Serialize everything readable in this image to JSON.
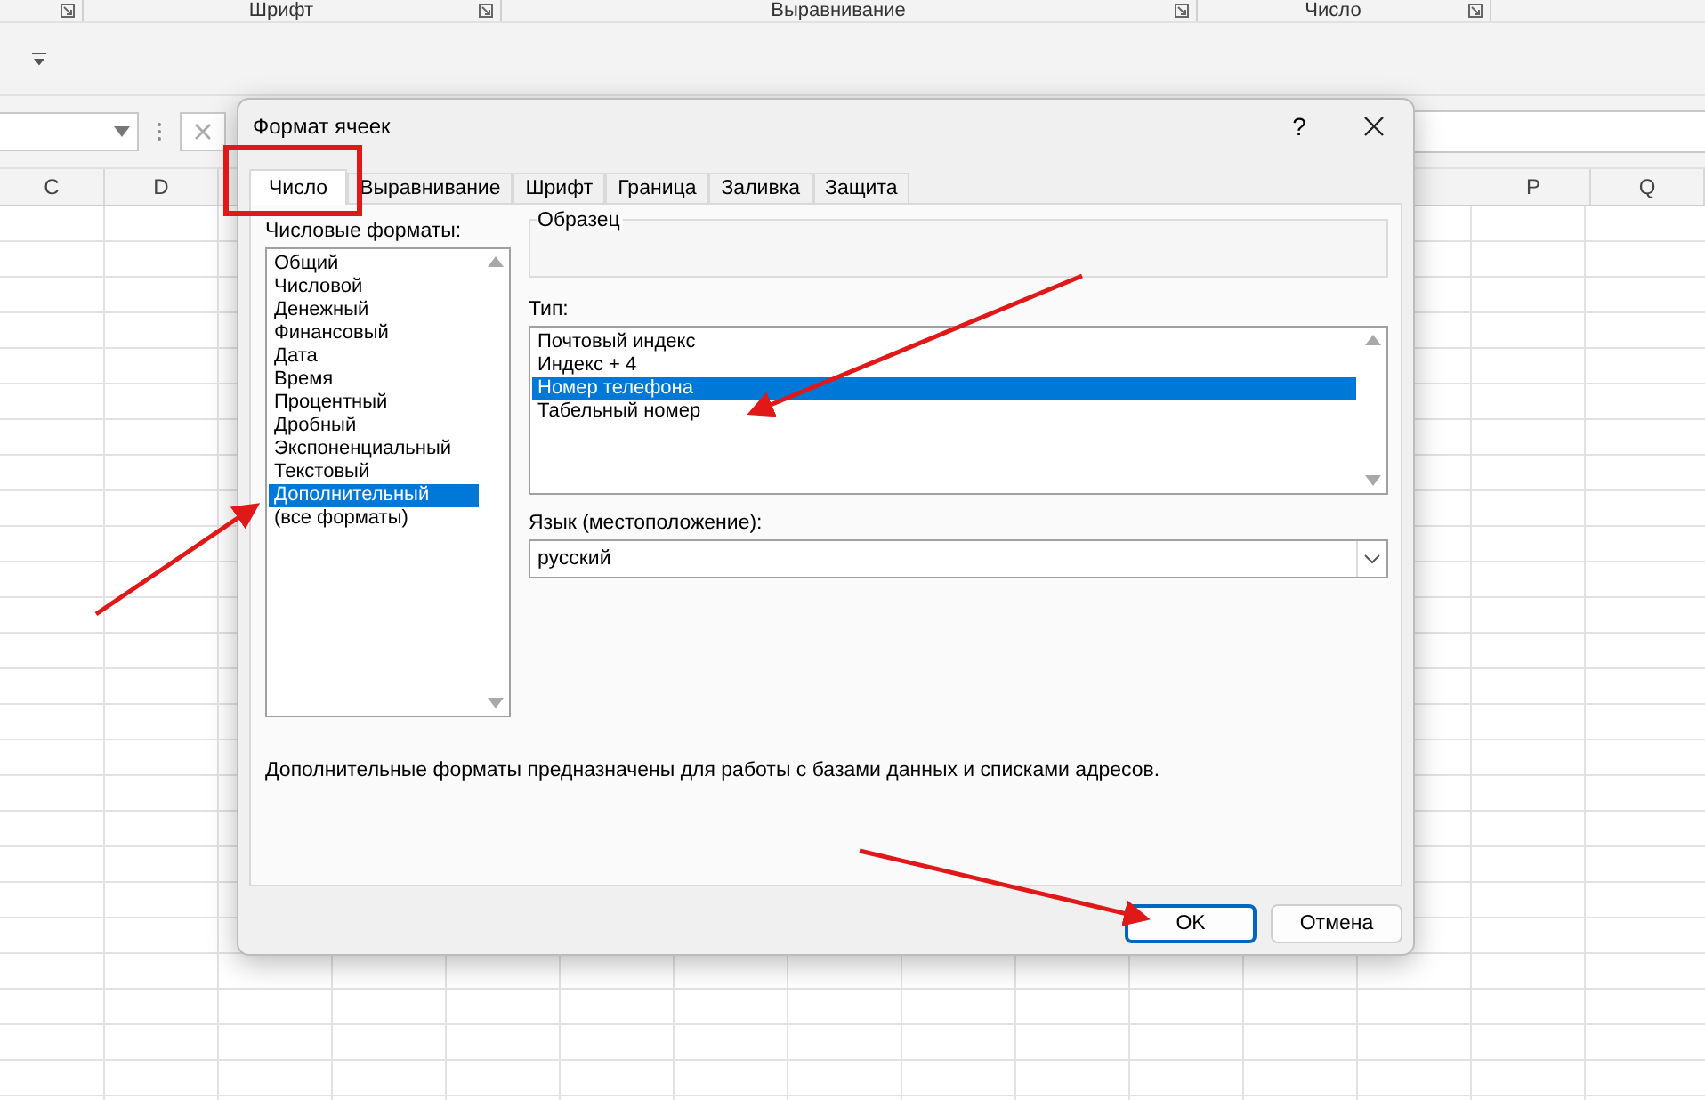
{
  "ribbon": {
    "groups": [
      {
        "label": "Шрифт"
      },
      {
        "label": "Выравнивание"
      },
      {
        "label": "Число"
      }
    ]
  },
  "column_headers_left": [
    "C",
    "D"
  ],
  "column_headers_right": [
    "P",
    "Q"
  ],
  "dialog": {
    "title": "Формат ячеек",
    "help": "?",
    "tabs": [
      {
        "label": "Число",
        "selected": true
      },
      {
        "label": "Выравнивание",
        "selected": false
      },
      {
        "label": "Шрифт",
        "selected": false
      },
      {
        "label": "Граница",
        "selected": false
      },
      {
        "label": "Заливка",
        "selected": false
      },
      {
        "label": "Защита",
        "selected": false
      }
    ],
    "number_formats": {
      "label": "Числовые форматы:",
      "items": [
        {
          "label": "Общий",
          "selected": false
        },
        {
          "label": "Числовой",
          "selected": false
        },
        {
          "label": "Денежный",
          "selected": false
        },
        {
          "label": "Финансовый",
          "selected": false
        },
        {
          "label": "Дата",
          "selected": false
        },
        {
          "label": "Время",
          "selected": false
        },
        {
          "label": "Процентный",
          "selected": false
        },
        {
          "label": "Дробный",
          "selected": false
        },
        {
          "label": "Экспоненциальный",
          "selected": false
        },
        {
          "label": "Текстовый",
          "selected": false
        },
        {
          "label": "Дополнительный",
          "selected": true
        },
        {
          "label": "(все форматы)",
          "selected": false
        }
      ]
    },
    "sample": {
      "label": "Образец"
    },
    "type": {
      "label": "Тип:",
      "items": [
        {
          "label": "Почтовый индекс",
          "selected": false
        },
        {
          "label": "Индекс + 4",
          "selected": false
        },
        {
          "label": "Номер телефона",
          "selected": true
        },
        {
          "label": "Табельный номер",
          "selected": false
        }
      ]
    },
    "locale": {
      "label": "Язык (местоположение):",
      "value": "русский"
    },
    "description": "Дополнительные форматы предназначены для работы с базами данных и списками адресов.",
    "buttons": [
      {
        "label": "OK",
        "default": true
      },
      {
        "label": "Отмена",
        "default": false
      }
    ]
  }
}
